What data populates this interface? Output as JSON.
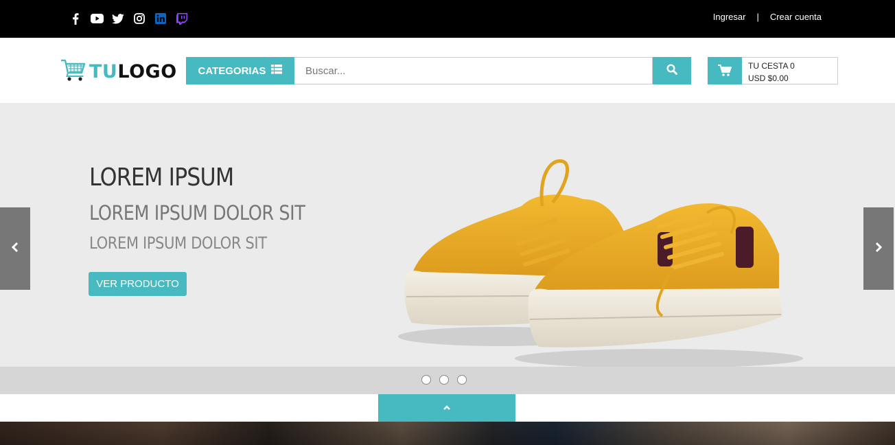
{
  "topbar": {
    "social_icons": [
      "facebook-icon",
      "youtube-icon",
      "twitter-icon",
      "instagram-icon",
      "linkedin-icon",
      "twitch-icon"
    ],
    "login_label": "Ingresar",
    "separator": "|",
    "register_label": "Crear cuenta"
  },
  "header": {
    "logo_prefix": "TU",
    "logo_suffix": "LOGO",
    "categories_label": "CATEGORIAS",
    "search_placeholder": "Buscar...",
    "cart_line1": "TU CESTA 0",
    "cart_line2": "USD $0.00"
  },
  "slider": {
    "title": "LOREM IPSUM",
    "subtitle": "LOREM IPSUM DOLOR SIT",
    "subtitle2": "LOREM IPSUM DOLOR SIT",
    "button_label": "VER PRODUCTO",
    "dots_count": 3
  },
  "colors": {
    "accent": "#47bac1",
    "topbar_bg": "#000000",
    "slider_bg": "#ebebeb",
    "shoe_color": "#e5a822",
    "linkedin": "#0a66c2",
    "twitch": "#9146ff"
  }
}
